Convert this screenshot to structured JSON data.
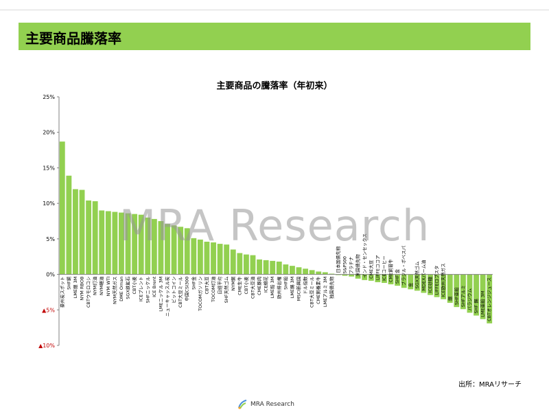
{
  "header": {
    "title": "主要商品騰落率"
  },
  "footer": {
    "source": "出所：MRAリサーチ",
    "logo_text": "MRA Research"
  },
  "watermark": "MRA Research",
  "colors": {
    "bar": "#92d050",
    "header": "#92d050",
    "negative_label": "#c00000"
  },
  "chart_data": {
    "type": "bar",
    "title": "主要商品の騰落率（年初来）",
    "ylim": [
      -10,
      25
    ],
    "yticks": [
      {
        "value": 25,
        "label": "25%"
      },
      {
        "value": 20,
        "label": "20%"
      },
      {
        "value": 15,
        "label": "15%"
      },
      {
        "value": 10,
        "label": "10%"
      },
      {
        "value": 5,
        "label": "5%"
      },
      {
        "value": 0,
        "label": "0%"
      },
      {
        "value": -5,
        "label": "▲5%"
      },
      {
        "value": -10,
        "label": "▲10%"
      }
    ],
    "grid": false,
    "legend": "none",
    "categories": [
      "豪州炭スポット",
      "SHF銅",
      "LME銀 3M",
      "NYM RBOB",
      "CBTウモロコシ",
      "NYM灯油",
      "NYM軽油",
      "NYM WTI",
      "NYM天然ガス",
      "DME Oman",
      "SGX鉄鉱石",
      "CBT小麦",
      "ICEブレント",
      "SHFニッケル",
      "ICE Brent",
      "LMEニッケル 3M",
      "ニューキャッスル炭",
      "ビットコイン",
      "CBT大豆ミール",
      "中国CSI300",
      "SHF金",
      "TOCOMガソリン",
      "CBT大豆",
      "TOCOM灯油",
      "日経平均",
      "SHF天然ゴム",
      "NYM銅",
      "CME生牛",
      "CBT小麦",
      "CBT大豆油",
      "CME豚肉",
      "ICE綿花",
      "LME鉛 3M",
      "欧州排出権",
      "SHF鉛",
      "LME錫 3M",
      "MSCI新興国",
      "ドル指数",
      "CBT大豆ミール",
      "CME飼養素牛",
      "LMEアルミ 3M",
      "独国債先物",
      "日本国債先物",
      "S&P500",
      "プラチナ",
      "米国債先物",
      "インド・センセックス",
      "CME大豆",
      "LIFFEココア",
      "ICEコーヒー",
      "CME飼育牛",
      "SHF 金",
      "ブラジル・ボベスパ",
      "金",
      "SGX天然ゴム",
      "MDEXパーム油",
      "ICE砂糖",
      "LIFFEロブスタ",
      "ICE欧州天然ガス",
      "銀",
      "SHF亜鉛",
      "SHFアルミ",
      "パラジウム",
      "SHF 錫",
      "LME亜鉛 3M",
      "CBTオレンジジュース"
    ],
    "values": [
      18.7,
      13.9,
      12.0,
      11.9,
      10.4,
      10.3,
      9.0,
      8.9,
      8.8,
      8.7,
      8.6,
      8.5,
      8.4,
      8.0,
      7.8,
      7.5,
      7.1,
      6.9,
      6.7,
      6.5,
      5.1,
      4.9,
      4.6,
      4.5,
      4.3,
      4.2,
      3.5,
      3.0,
      2.8,
      2.7,
      2.1,
      2.0,
      1.9,
      1.8,
      1.4,
      1.2,
      1.0,
      0.8,
      0.6,
      0.4,
      0.3,
      0.1,
      -0.1,
      -0.2,
      -0.3,
      -0.6,
      -0.8,
      -0.9,
      -1.1,
      -1.2,
      -1.4,
      -1.6,
      -1.9,
      -2.1,
      -2.3,
      -2.6,
      -2.9,
      -3.2,
      -3.5,
      -4.0,
      -4.6,
      -4.9,
      -5.4,
      -5.8,
      -6.3,
      -6.9
    ]
  }
}
